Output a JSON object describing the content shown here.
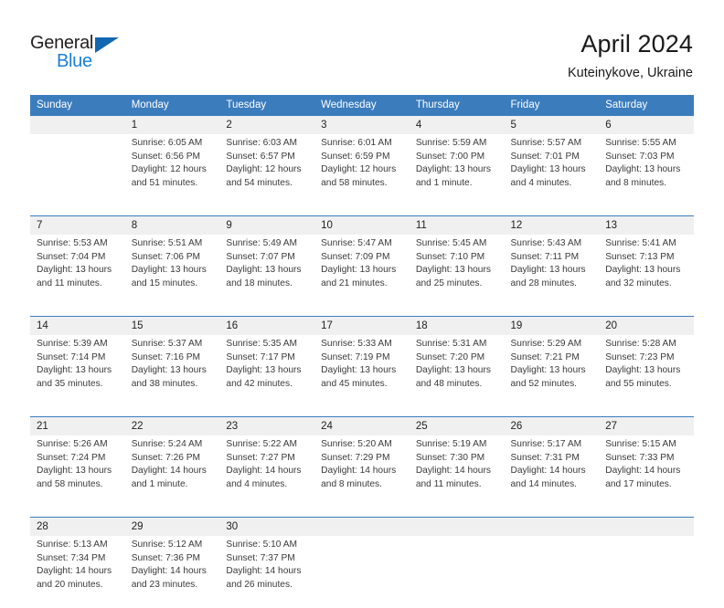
{
  "brand": {
    "name_part1": "General",
    "name_part2": "Blue",
    "accent_color": "#1b7fd4",
    "triangle_color": "#1267b1"
  },
  "header": {
    "month_title": "April 2024",
    "location": "Kuteinykove, Ukraine"
  },
  "calendar": {
    "header_bg": "#3b7cbd",
    "daynum_bg": "#f0f0f0",
    "weekdays": [
      "Sunday",
      "Monday",
      "Tuesday",
      "Wednesday",
      "Thursday",
      "Friday",
      "Saturday"
    ],
    "weeks": [
      {
        "days": [
          {
            "num": "",
            "empty": true,
            "sunrise": "",
            "sunset": "",
            "daylight1": "",
            "daylight2": ""
          },
          {
            "num": "1",
            "sunrise": "Sunrise: 6:05 AM",
            "sunset": "Sunset: 6:56 PM",
            "daylight1": "Daylight: 12 hours",
            "daylight2": "and 51 minutes."
          },
          {
            "num": "2",
            "sunrise": "Sunrise: 6:03 AM",
            "sunset": "Sunset: 6:57 PM",
            "daylight1": "Daylight: 12 hours",
            "daylight2": "and 54 minutes."
          },
          {
            "num": "3",
            "sunrise": "Sunrise: 6:01 AM",
            "sunset": "Sunset: 6:59 PM",
            "daylight1": "Daylight: 12 hours",
            "daylight2": "and 58 minutes."
          },
          {
            "num": "4",
            "sunrise": "Sunrise: 5:59 AM",
            "sunset": "Sunset: 7:00 PM",
            "daylight1": "Daylight: 13 hours",
            "daylight2": "and 1 minute."
          },
          {
            "num": "5",
            "sunrise": "Sunrise: 5:57 AM",
            "sunset": "Sunset: 7:01 PM",
            "daylight1": "Daylight: 13 hours",
            "daylight2": "and 4 minutes."
          },
          {
            "num": "6",
            "sunrise": "Sunrise: 5:55 AM",
            "sunset": "Sunset: 7:03 PM",
            "daylight1": "Daylight: 13 hours",
            "daylight2": "and 8 minutes."
          }
        ]
      },
      {
        "days": [
          {
            "num": "7",
            "sunrise": "Sunrise: 5:53 AM",
            "sunset": "Sunset: 7:04 PM",
            "daylight1": "Daylight: 13 hours",
            "daylight2": "and 11 minutes."
          },
          {
            "num": "8",
            "sunrise": "Sunrise: 5:51 AM",
            "sunset": "Sunset: 7:06 PM",
            "daylight1": "Daylight: 13 hours",
            "daylight2": "and 15 minutes."
          },
          {
            "num": "9",
            "sunrise": "Sunrise: 5:49 AM",
            "sunset": "Sunset: 7:07 PM",
            "daylight1": "Daylight: 13 hours",
            "daylight2": "and 18 minutes."
          },
          {
            "num": "10",
            "sunrise": "Sunrise: 5:47 AM",
            "sunset": "Sunset: 7:09 PM",
            "daylight1": "Daylight: 13 hours",
            "daylight2": "and 21 minutes."
          },
          {
            "num": "11",
            "sunrise": "Sunrise: 5:45 AM",
            "sunset": "Sunset: 7:10 PM",
            "daylight1": "Daylight: 13 hours",
            "daylight2": "and 25 minutes."
          },
          {
            "num": "12",
            "sunrise": "Sunrise: 5:43 AM",
            "sunset": "Sunset: 7:11 PM",
            "daylight1": "Daylight: 13 hours",
            "daylight2": "and 28 minutes."
          },
          {
            "num": "13",
            "sunrise": "Sunrise: 5:41 AM",
            "sunset": "Sunset: 7:13 PM",
            "daylight1": "Daylight: 13 hours",
            "daylight2": "and 32 minutes."
          }
        ]
      },
      {
        "days": [
          {
            "num": "14",
            "sunrise": "Sunrise: 5:39 AM",
            "sunset": "Sunset: 7:14 PM",
            "daylight1": "Daylight: 13 hours",
            "daylight2": "and 35 minutes."
          },
          {
            "num": "15",
            "sunrise": "Sunrise: 5:37 AM",
            "sunset": "Sunset: 7:16 PM",
            "daylight1": "Daylight: 13 hours",
            "daylight2": "and 38 minutes."
          },
          {
            "num": "16",
            "sunrise": "Sunrise: 5:35 AM",
            "sunset": "Sunset: 7:17 PM",
            "daylight1": "Daylight: 13 hours",
            "daylight2": "and 42 minutes."
          },
          {
            "num": "17",
            "sunrise": "Sunrise: 5:33 AM",
            "sunset": "Sunset: 7:19 PM",
            "daylight1": "Daylight: 13 hours",
            "daylight2": "and 45 minutes."
          },
          {
            "num": "18",
            "sunrise": "Sunrise: 5:31 AM",
            "sunset": "Sunset: 7:20 PM",
            "daylight1": "Daylight: 13 hours",
            "daylight2": "and 48 minutes."
          },
          {
            "num": "19",
            "sunrise": "Sunrise: 5:29 AM",
            "sunset": "Sunset: 7:21 PM",
            "daylight1": "Daylight: 13 hours",
            "daylight2": "and 52 minutes."
          },
          {
            "num": "20",
            "sunrise": "Sunrise: 5:28 AM",
            "sunset": "Sunset: 7:23 PM",
            "daylight1": "Daylight: 13 hours",
            "daylight2": "and 55 minutes."
          }
        ]
      },
      {
        "days": [
          {
            "num": "21",
            "sunrise": "Sunrise: 5:26 AM",
            "sunset": "Sunset: 7:24 PM",
            "daylight1": "Daylight: 13 hours",
            "daylight2": "and 58 minutes."
          },
          {
            "num": "22",
            "sunrise": "Sunrise: 5:24 AM",
            "sunset": "Sunset: 7:26 PM",
            "daylight1": "Daylight: 14 hours",
            "daylight2": "and 1 minute."
          },
          {
            "num": "23",
            "sunrise": "Sunrise: 5:22 AM",
            "sunset": "Sunset: 7:27 PM",
            "daylight1": "Daylight: 14 hours",
            "daylight2": "and 4 minutes."
          },
          {
            "num": "24",
            "sunrise": "Sunrise: 5:20 AM",
            "sunset": "Sunset: 7:29 PM",
            "daylight1": "Daylight: 14 hours",
            "daylight2": "and 8 minutes."
          },
          {
            "num": "25",
            "sunrise": "Sunrise: 5:19 AM",
            "sunset": "Sunset: 7:30 PM",
            "daylight1": "Daylight: 14 hours",
            "daylight2": "and 11 minutes."
          },
          {
            "num": "26",
            "sunrise": "Sunrise: 5:17 AM",
            "sunset": "Sunset: 7:31 PM",
            "daylight1": "Daylight: 14 hours",
            "daylight2": "and 14 minutes."
          },
          {
            "num": "27",
            "sunrise": "Sunrise: 5:15 AM",
            "sunset": "Sunset: 7:33 PM",
            "daylight1": "Daylight: 14 hours",
            "daylight2": "and 17 minutes."
          }
        ]
      },
      {
        "days": [
          {
            "num": "28",
            "sunrise": "Sunrise: 5:13 AM",
            "sunset": "Sunset: 7:34 PM",
            "daylight1": "Daylight: 14 hours",
            "daylight2": "and 20 minutes."
          },
          {
            "num": "29",
            "sunrise": "Sunrise: 5:12 AM",
            "sunset": "Sunset: 7:36 PM",
            "daylight1": "Daylight: 14 hours",
            "daylight2": "and 23 minutes."
          },
          {
            "num": "30",
            "sunrise": "Sunrise: 5:10 AM",
            "sunset": "Sunset: 7:37 PM",
            "daylight1": "Daylight: 14 hours",
            "daylight2": "and 26 minutes."
          },
          {
            "num": "",
            "empty": true,
            "sunrise": "",
            "sunset": "",
            "daylight1": "",
            "daylight2": ""
          },
          {
            "num": "",
            "empty": true,
            "sunrise": "",
            "sunset": "",
            "daylight1": "",
            "daylight2": ""
          },
          {
            "num": "",
            "empty": true,
            "sunrise": "",
            "sunset": "",
            "daylight1": "",
            "daylight2": ""
          },
          {
            "num": "",
            "empty": true,
            "sunrise": "",
            "sunset": "",
            "daylight1": "",
            "daylight2": ""
          }
        ]
      }
    ]
  }
}
